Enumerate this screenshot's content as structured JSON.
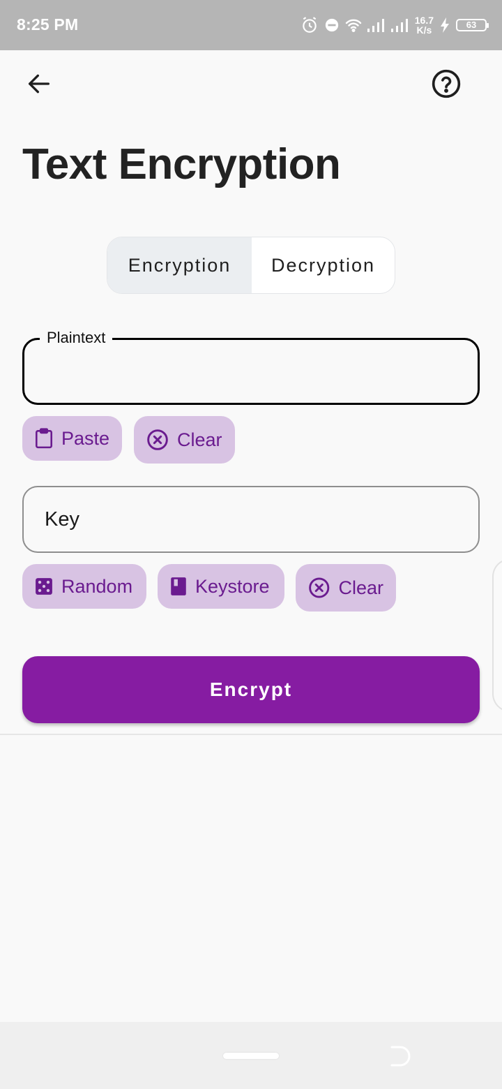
{
  "status_bar": {
    "time": "8:25 PM",
    "net_speed_value": "16.7",
    "net_speed_unit": "K/s",
    "battery_level": "63",
    "icons": [
      "alarm-icon",
      "do-not-disturb-icon",
      "wifi-icon",
      "signal-icon",
      "signal-icon",
      "charging-icon",
      "battery-icon"
    ]
  },
  "app_bar": {
    "back_icon": "arrow-left-icon",
    "help_icon": "help-circle-icon"
  },
  "page": {
    "title": "Text Encryption"
  },
  "mode_toggle": {
    "options": [
      "Encryption",
      "Decryption"
    ],
    "selected": "Encryption"
  },
  "plaintext_field": {
    "label": "Plaintext",
    "value": ""
  },
  "plaintext_actions": {
    "paste_label": "Paste",
    "clear_label": "Clear"
  },
  "key_field": {
    "label": "Key",
    "value": ""
  },
  "key_actions": {
    "random_label": "Random",
    "keystore_label": "Keystore",
    "clear_label": "Clear"
  },
  "primary_action": {
    "label": "Encrypt"
  },
  "colors": {
    "accent": "#861ca2",
    "chip_bg": "#d8c3e3",
    "chip_text": "#6a1b8f",
    "status_bar": "#b5b5b5"
  }
}
